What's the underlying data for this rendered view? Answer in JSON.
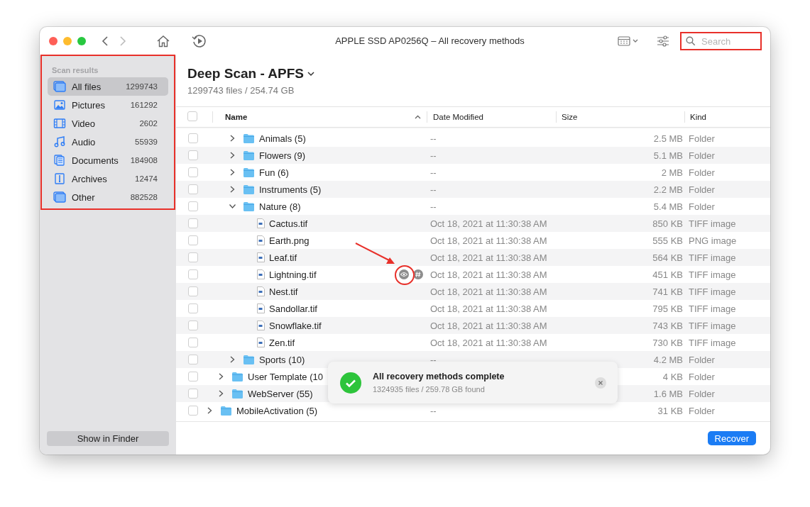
{
  "window": {
    "title": "APPLE SSD AP0256Q – All recovery methods"
  },
  "toolbar": {
    "search": {
      "placeholder": "Search"
    }
  },
  "sidebar": {
    "heading": "Scan results",
    "items": [
      {
        "kind": "all",
        "label": "All files",
        "count": "1299743",
        "selected": true
      },
      {
        "kind": "pictures",
        "label": "Pictures",
        "count": "161292",
        "selected": false
      },
      {
        "kind": "video",
        "label": "Video",
        "count": "2602",
        "selected": false
      },
      {
        "kind": "audio",
        "label": "Audio",
        "count": "55939",
        "selected": false
      },
      {
        "kind": "documents",
        "label": "Documents",
        "count": "184908",
        "selected": false
      },
      {
        "kind": "archives",
        "label": "Archives",
        "count": "12474",
        "selected": false
      },
      {
        "kind": "other",
        "label": "Other",
        "count": "882528",
        "selected": false
      }
    ],
    "footer_button": "Show in Finder"
  },
  "scan": {
    "title": "Deep Scan - APFS",
    "summary": "1299743 files / 254.74 GB"
  },
  "table": {
    "select_all": {
      "checked": false
    },
    "columns": [
      {
        "label": "Name",
        "sorted": true
      },
      {
        "label": "Date Modified",
        "sorted": false
      },
      {
        "label": "Size",
        "sorted": false
      },
      {
        "label": "Kind",
        "sorted": false
      }
    ],
    "rows": [
      {
        "children": [
          {
            "children": [
              {
                "kind": "folder",
                "name": "Animals (5)",
                "expanded": false,
                "checked": false,
                "hovered": false,
                "date": "--",
                "size": "2.5 MB",
                "type": "Folder"
              },
              {
                "kind": "folder",
                "name": "Flowers (9)",
                "expanded": false,
                "checked": false,
                "hovered": false,
                "date": "--",
                "size": "5.1 MB",
                "type": "Folder"
              },
              {
                "kind": "folder",
                "name": "Fun (6)",
                "expanded": false,
                "checked": false,
                "hovered": false,
                "date": "--",
                "size": "2 MB",
                "type": "Folder"
              },
              {
                "kind": "folder",
                "name": "Instruments (5)",
                "expanded": false,
                "checked": false,
                "hovered": false,
                "date": "--",
                "size": "2.2 MB",
                "type": "Folder"
              },
              {
                "kind": "folder",
                "name": "Nature (8)",
                "expanded": true,
                "checked": false,
                "hovered": false,
                "date": "--",
                "size": "5.4 MB",
                "type": "Folder",
                "children": [
                  {
                    "kind": "file",
                    "name": "Cactus.tif",
                    "checked": false,
                    "hovered": false,
                    "date": "Oct 18, 2021 at 11:30:38 AM",
                    "size": "850 KB",
                    "type": "TIFF image"
                  },
                  {
                    "kind": "file",
                    "name": "Earth.png",
                    "checked": false,
                    "hovered": false,
                    "date": "Oct 18, 2021 at 11:30:38 AM",
                    "size": "555 KB",
                    "type": "PNG image"
                  },
                  {
                    "kind": "file",
                    "name": "Leaf.tif",
                    "checked": false,
                    "hovered": false,
                    "date": "Oct 18, 2021 at 11:30:38 AM",
                    "size": "564 KB",
                    "type": "TIFF image"
                  },
                  {
                    "kind": "file",
                    "name": "Lightning.tif",
                    "checked": false,
                    "hovered": true,
                    "date": "Oct 18, 2021 at 11:30:38 AM",
                    "size": "451 KB",
                    "type": "TIFF image"
                  },
                  {
                    "kind": "file",
                    "name": "Nest.tif",
                    "checked": false,
                    "hovered": false,
                    "date": "Oct 18, 2021 at 11:30:38 AM",
                    "size": "741 KB",
                    "type": "TIFF image"
                  },
                  {
                    "kind": "file",
                    "name": "Sandollar.tif",
                    "checked": false,
                    "hovered": false,
                    "date": "Oct 18, 2021 at 11:30:38 AM",
                    "size": "795 KB",
                    "type": "TIFF image"
                  },
                  {
                    "kind": "file",
                    "name": "Snowflake.tif",
                    "checked": false,
                    "hovered": false,
                    "date": "Oct 18, 2021 at 11:30:38 AM",
                    "size": "743 KB",
                    "type": "TIFF image"
                  },
                  {
                    "kind": "file",
                    "name": "Zen.tif",
                    "checked": false,
                    "hovered": false,
                    "date": "Oct 18, 2021 at 11:30:38 AM",
                    "size": "730 KB",
                    "type": "TIFF image"
                  }
                ]
              },
              {
                "kind": "folder",
                "name": "Sports (10)",
                "expanded": false,
                "checked": false,
                "hovered": false,
                "date": "--",
                "size": "4.2 MB",
                "type": "Folder"
              }
            ]
          },
          {
            "kind": "folder",
            "name": "User Template (10",
            "expanded": false,
            "checked": false,
            "hovered": false,
            "size": "4 KB",
            "type": "Folder"
          },
          {
            "kind": "folder",
            "name": "WebServer (55)",
            "expanded": false,
            "checked": false,
            "hovered": false,
            "size": "1.6 MB",
            "type": "Folder"
          }
        ]
      },
      {
        "kind": "folder",
        "name": "MobileActivation (5)",
        "expanded": false,
        "checked": false,
        "hovered": false,
        "date": "--",
        "size": "31 KB",
        "type": "Folder"
      }
    ]
  },
  "toast": {
    "title": "All recovery methods complete",
    "detail": "1324935 files / 259.78 GB found"
  },
  "recover_button": "Recover",
  "annotations": {
    "sidebar_frame": true,
    "search_frame": true,
    "preview_pointer": true
  }
}
